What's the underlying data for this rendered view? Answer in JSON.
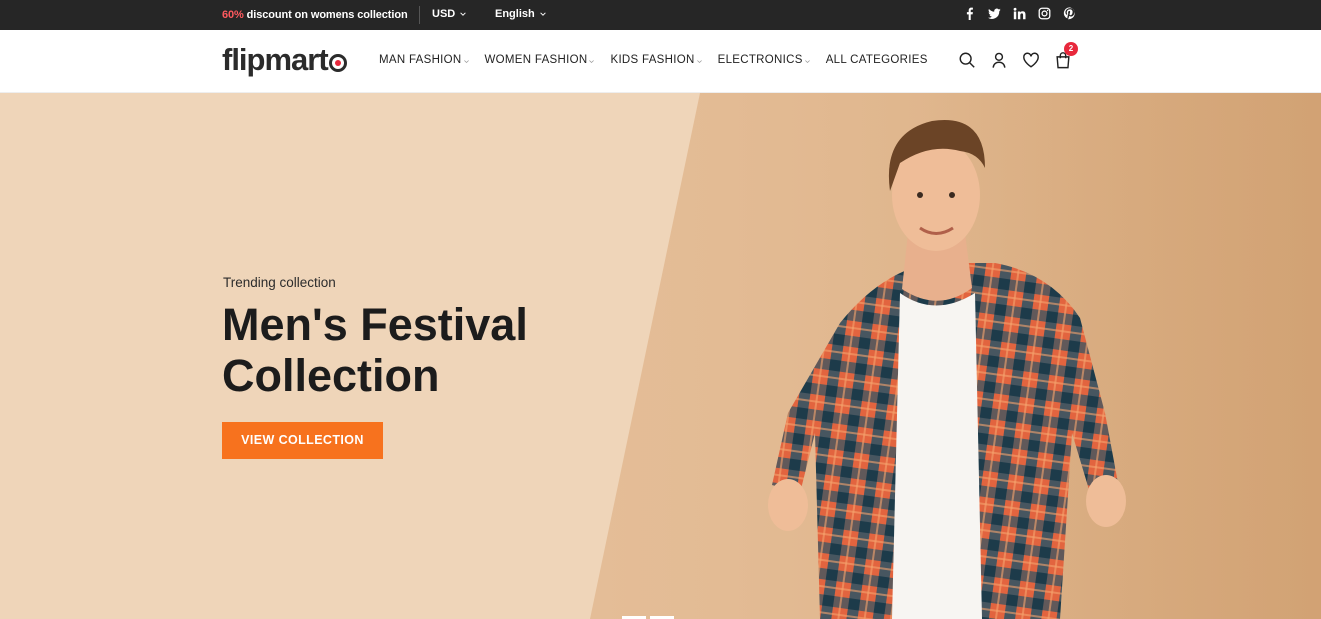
{
  "topbar": {
    "promo_highlight": "60%",
    "promo_text": " discount on womens collection",
    "currency": "USD",
    "language": "English",
    "social_icons": [
      "facebook-icon",
      "twitter-icon",
      "linkedin-icon",
      "instagram-icon",
      "pinterest-icon"
    ]
  },
  "header": {
    "logo_text": "flipmart",
    "nav": [
      {
        "label": "MAN FASHION",
        "dropdown": true
      },
      {
        "label": "WOMEN FASHION",
        "dropdown": true
      },
      {
        "label": "KIDS FASHION",
        "dropdown": true
      },
      {
        "label": "ELECTRONICS",
        "dropdown": true
      },
      {
        "label": "ALL CATEGORIES",
        "dropdown": false
      }
    ],
    "icons": [
      "search-icon",
      "user-icon",
      "heart-icon",
      "bag-icon"
    ],
    "cart_count": "2"
  },
  "hero": {
    "subtitle": "Trending collection",
    "title": "Men's Festival Collection",
    "cta_label": "VIEW COLLECTION"
  },
  "colors": {
    "topbar_bg": "#262626",
    "accent": "#f7721e",
    "highlight": "#ff5a5f",
    "badge": "#e8283c"
  }
}
